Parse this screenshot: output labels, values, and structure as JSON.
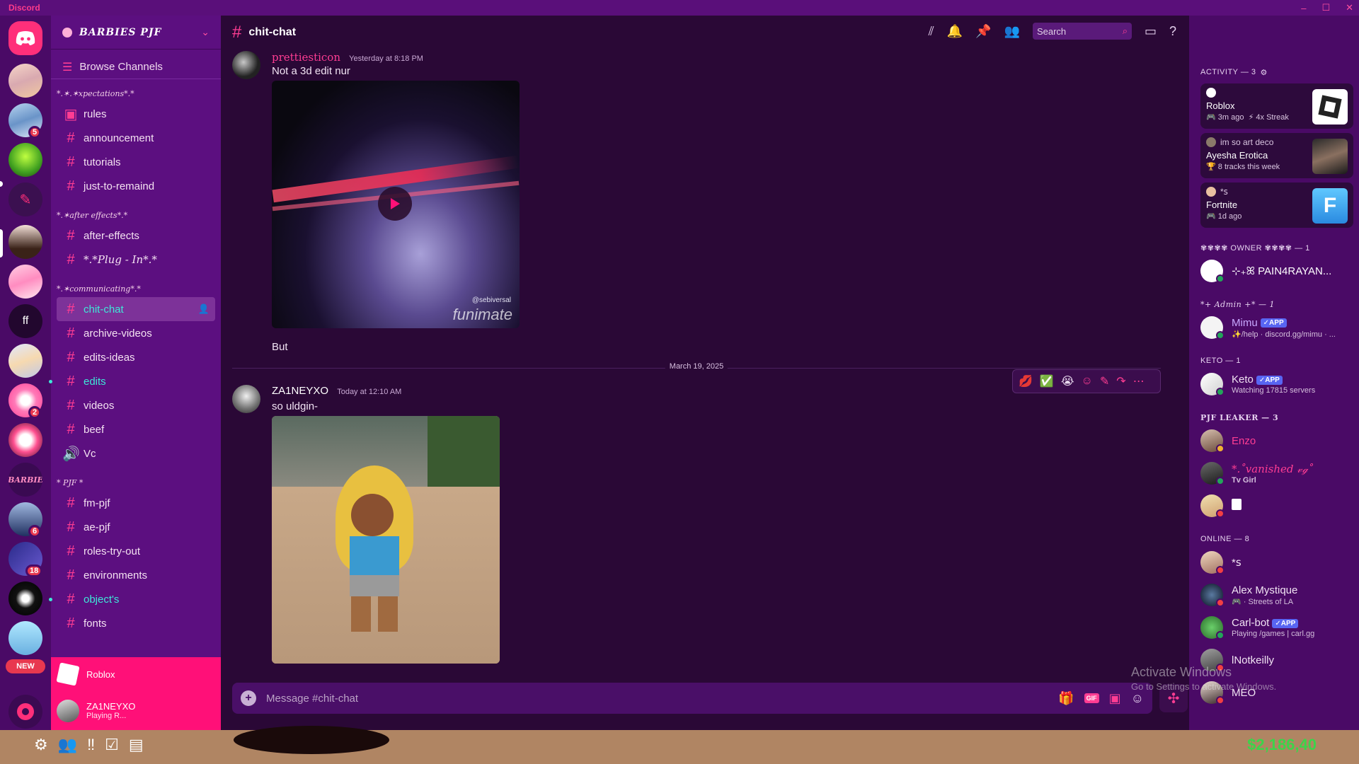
{
  "app": {
    "name": "Discord"
  },
  "window": {
    "minimize": "–",
    "maximize": "☐",
    "close": "✕"
  },
  "servers": {
    "badges": [
      "5",
      "2",
      "6",
      "18"
    ],
    "ff_label": "ff",
    "new_label": "NEW"
  },
  "guild": {
    "name": "BARBIES PJF"
  },
  "sidebar": {
    "browse": "Browse Channels",
    "categories": [
      {
        "label": "*.✶.✶xpectations*.*",
        "channels": [
          "rules",
          "announcement",
          "tutorials",
          "just-to-remaind"
        ]
      },
      {
        "label": "*.✶after effects*.*",
        "channels": [
          "after-effects",
          "*.*Plug - In*.*"
        ]
      },
      {
        "label": "*.✶communicating*.*",
        "channels": [
          "chit-chat",
          "archive-videos",
          "edits-ideas",
          "edits",
          "videos",
          "beef",
          "Vc"
        ]
      },
      {
        "label": "* PJF *",
        "channels": [
          "fm-pjf",
          "ae-pjf",
          "roles-try-out",
          "environments",
          "object's",
          "fonts"
        ]
      }
    ],
    "activity_game": "Roblox",
    "user": {
      "name": "ZA1NEYXO",
      "status": "Playing R..."
    }
  },
  "chat": {
    "channel": "chit-chat",
    "search_placeholder": "Search",
    "messages": [
      {
        "author": "prettiesticon",
        "time": "Yesterday at 8:18 PM",
        "text": "Not a 3d edit nur",
        "after": "But",
        "video_watermark": "funimate",
        "video_credit": "@sebiversal"
      },
      {
        "author": "ZA1NEYXO",
        "time": "Today at 12:10 AM",
        "text": "so uldgin-"
      }
    ],
    "date_divider": "March 19, 2025",
    "composer_placeholder": "Message #chit-chat",
    "gif_label": "GIF"
  },
  "members": {
    "activity_header": "ACTIVITY — 3",
    "activity": [
      {
        "line1": "",
        "title": "Roblox",
        "meta1": "3m ago",
        "meta2": "4x Streak"
      },
      {
        "line1": "im so art deco",
        "title": "Ayesha Erotica",
        "meta1": "8 tracks this week",
        "meta2": ""
      },
      {
        "line1": "*ꜱ",
        "title": "Fortnite",
        "meta1": "1d ago",
        "meta2": ""
      }
    ],
    "sections": [
      {
        "header": "✾✾✾✾ OWNER ✾✾✾✾ — 1",
        "items": [
          {
            "name": "⊹₊ꕤ PAIN4RAYAN...",
            "sub": "",
            "app": false
          }
        ]
      },
      {
        "header": "*+ Admin +* — 1",
        "items": [
          {
            "name": "Mimu",
            "sub": "✨/help · discord.gg/mimu · ...",
            "app": true
          }
        ]
      },
      {
        "header": "KETO — 1",
        "items": [
          {
            "name": "Keto",
            "sub": "Watching 17815 servers",
            "app": true
          }
        ]
      },
      {
        "header": "PJF LEAKER — 3",
        "items": [
          {
            "name": "Enzo",
            "sub": "",
            "app": false
          },
          {
            "name": "*.˚vanished 𝓋ℊ˚",
            "sub": "Tv Girl",
            "app": false
          },
          {
            "name": "",
            "sub": "",
            "app": false
          }
        ]
      },
      {
        "header": "ONLINE — 8",
        "items": [
          {
            "name": "*ꜱ",
            "sub": "",
            "app": false
          },
          {
            "name": "Alex Mystique",
            "sub": "Streets of LA",
            "app": false
          },
          {
            "name": "Carl-bot",
            "sub": "Playing /games | carl.gg",
            "app": true
          },
          {
            "name": "lNotkeilly",
            "sub": "",
            "app": false
          },
          {
            "name": "MEO",
            "sub": "",
            "app": false
          }
        ]
      }
    ],
    "app_tag": "✓APP"
  },
  "overlay": {
    "activate_title": "Activate Windows",
    "activate_sub": "Go to Settings to activate Windows.",
    "cash": "$2,186,40"
  },
  "colors": {
    "accent": "#ff1078",
    "rail": "#4a0a66",
    "sidebar": "#5c0f80",
    "chat": "#2a0836",
    "teal": "#3ee8d8"
  }
}
